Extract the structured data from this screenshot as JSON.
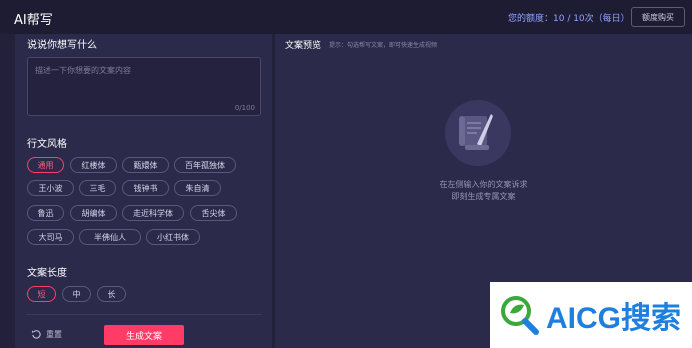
{
  "header": {
    "title": "AI帮写",
    "quota_label": "您的额度：10 / 10次（每日）",
    "buy_button": "额度购买"
  },
  "left": {
    "prompt_title": "说说你想写什么",
    "textarea_placeholder": "描述一下你想要的文案内容",
    "counter": "0/100",
    "style_title": "行文风格",
    "styles": [
      "通用",
      "红楼体",
      "甄嬛体",
      "百年孤独体",
      "王小波",
      "三毛",
      "钱钟书",
      "朱自清",
      "鲁迅",
      "胡编体",
      "走近科学体",
      "舌尖体",
      "大司马",
      "半佛仙人",
      "小红书体"
    ],
    "selected_style": "通用",
    "length_title": "文案长度",
    "lengths": [
      "短",
      "中",
      "长"
    ],
    "selected_length": "短",
    "reset_label": "重置",
    "generate_label": "生成文案"
  },
  "preview": {
    "title": "文案预览",
    "hint": "提示：勾选帮写文案，即可快速生成视频",
    "empty_line1": "在左侧输入你的文案诉求",
    "empty_line2": "即刻生成专属文案"
  },
  "watermark": {
    "text": "AICG搜索"
  },
  "colors": {
    "accent": "#ff3b66",
    "panel": "#2c2a4a",
    "background": "#22203a",
    "quota_text": "#8fa3ff"
  }
}
